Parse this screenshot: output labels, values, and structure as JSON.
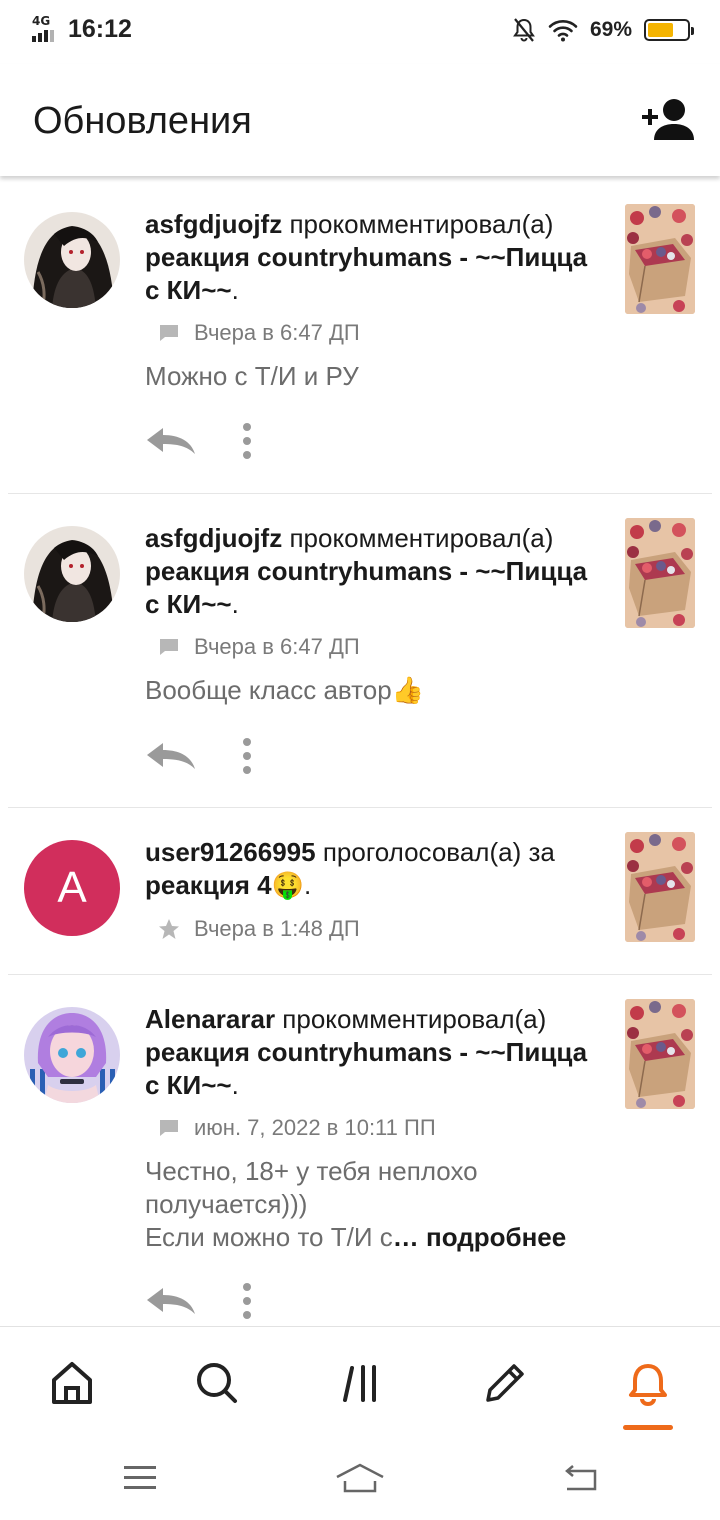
{
  "status_bar": {
    "network": "4G",
    "time": "16:12",
    "battery_percent": "69%",
    "battery_level": 0.69,
    "icons": [
      "signal-icon",
      "mute-bell-icon",
      "wifi-icon",
      "battery-icon"
    ]
  },
  "header": {
    "title": "Обновления",
    "action_icon": "add-user-icon"
  },
  "feed": [
    {
      "user": "asfgdjuojfz",
      "action": " прокомментировал(а)",
      "work": "реакция countryhumans - ~~Пицца с КИ~~",
      "suffix": ".",
      "meta_icon": "comment-icon",
      "time": "Вчера в 6:47 ДП",
      "comment": "Можно с Т/И и РУ"
    },
    {
      "user": "asfgdjuojfz",
      "action": " прокомментировал(а)",
      "work": "реакция countryhumans - ~~Пицца с КИ~~",
      "suffix": ".",
      "meta_icon": "comment-icon",
      "time": "Вчера в 6:47 ДП",
      "comment": "Вообще класс автор👍"
    },
    {
      "user": "user91266995",
      "action": " проголосовал(а) за ",
      "work": "реакция 4🤑",
      "suffix": ".",
      "avatar_letter": "A",
      "meta_icon": "star-icon",
      "time": "Вчера в 1:48 ДП",
      "comment": ""
    },
    {
      "user": "Alenararar",
      "action": " прокомментировал(а)",
      "work": "реакция countryhumans - ~~Пицца с КИ~~",
      "suffix": ".",
      "meta_icon": "comment-icon",
      "time": "июн. 7, 2022 в 10:11 ПП",
      "comment": "Честно, 18+ у тебя неплохо\n получается)))\nЕсли можно то Т/И  с",
      "comment_ellipsis": "… ",
      "more_label": "подробнее"
    }
  ],
  "bottom_nav": {
    "items": [
      "home-icon",
      "search-icon",
      "library-icon",
      "write-icon",
      "notifications-icon"
    ],
    "active": "notifications-icon"
  },
  "colors": {
    "accent": "#ee6a1a",
    "avatar_letter_bg": "#d12e5c",
    "battery_fill": "#f5b400",
    "muted_text": "#6c6c6c"
  }
}
